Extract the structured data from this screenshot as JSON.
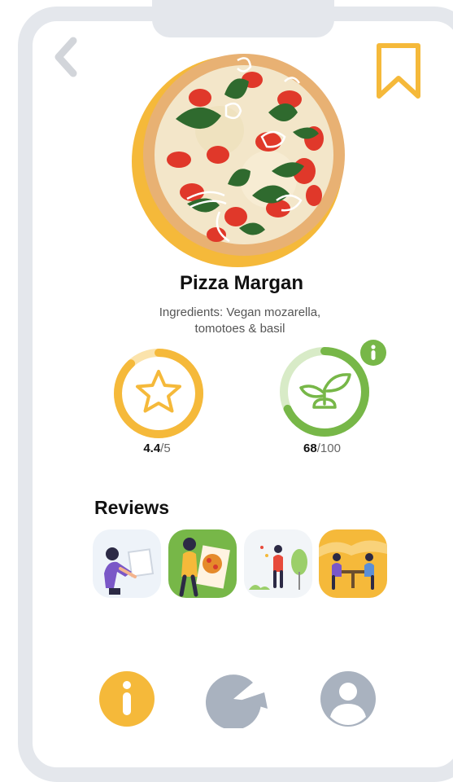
{
  "dish": {
    "title": "Pizza Margan",
    "ingredients_line1": "Ingredients: Vegan mozarella,",
    "ingredients_line2": "tomotoes &  basil"
  },
  "scores": {
    "rating_value": "4.4",
    "rating_max": "/5",
    "rating_fraction": 0.88,
    "eco_value": "68",
    "eco_max": "/100",
    "eco_fraction": 0.68
  },
  "reviews": {
    "title": "Reviews"
  },
  "colors": {
    "accent_yellow": "#f5b93a",
    "eco_green": "#77b748",
    "frame_gray": "#e4e7ec",
    "icon_gray": "#a9b2bf"
  },
  "icons": {
    "back": "chevron-left-icon",
    "bookmark": "bookmark-icon",
    "info": "info-icon",
    "rating": "star-icon",
    "eco": "sprout-icon",
    "tab_info": "info-icon",
    "tab_stats": "pie-chart-icon",
    "tab_profile": "user-icon"
  }
}
